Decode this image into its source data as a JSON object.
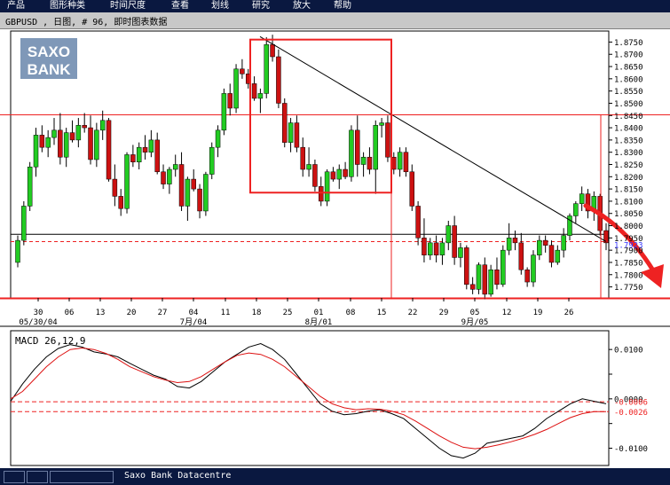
{
  "menu": {
    "items": [
      "产品",
      "图形种类",
      "时间尺度",
      "查看",
      "划线",
      "研究",
      "放大",
      "帮助"
    ]
  },
  "header": {
    "title": "GBPUSD , 日图, # 96, 即时图表数据"
  },
  "logo": {
    "line1": "SAXO",
    "line2": "BANK"
  },
  "status": {
    "text": "Saxo Bank Datacentre"
  },
  "colors": {
    "bull": "#22cc22",
    "bear": "#cc1111",
    "annotation": "#ee2222",
    "accent": "#0a1840"
  },
  "chart_data": [
    {
      "type": "candlestick",
      "title": "",
      "price_axis": {
        "range": [
          1.7705,
          1.8795
        ],
        "ticks": [
          "1.8750",
          "1.8700",
          "1.8650",
          "1.8600",
          "1.8550",
          "1.8500",
          "1.8450",
          "1.8400",
          "1.8350",
          "1.8300",
          "1.8250",
          "1.8200",
          "1.8150",
          "1.8100",
          "1.8050",
          "1.8000",
          "1.7950",
          "1.7900",
          "1.7850",
          "1.7800",
          "1.7750"
        ],
        "last_label": "1.7923"
      },
      "date_axis": {
        "day_labels": [
          "30",
          "06",
          "13",
          "20",
          "27",
          "04",
          "11",
          "18",
          "25",
          "01",
          "08",
          "15",
          "22",
          "29",
          "05",
          "12",
          "19",
          "26"
        ],
        "month_labels": [
          "05/30/04",
          "7月/04",
          "8月/01",
          "9月/05"
        ]
      },
      "trendline": {
        "from": [
          "07/18/04",
          1.8772
        ],
        "to": [
          "09/30/04",
          1.7935
        ]
      },
      "horizontal_levels": [
        1.8453,
        1.7965,
        1.7935
      ],
      "zones": [
        {
          "from": "07/16/04",
          "to": "08/17/04",
          "high": 1.876,
          "low": 1.8135
        },
        {
          "from": "08/17/04",
          "to": "09/29/04",
          "high": 1.8453,
          "low": 1.7705
        }
      ],
      "candles": [
        [
          1.785,
          1.796,
          1.783,
          1.794
        ],
        [
          1.794,
          1.81,
          1.792,
          1.808
        ],
        [
          1.808,
          1.826,
          1.806,
          1.824
        ],
        [
          1.824,
          1.84,
          1.82,
          1.837
        ],
        [
          1.837,
          1.841,
          1.83,
          1.832
        ],
        [
          1.832,
          1.839,
          1.828,
          1.836
        ],
        [
          1.836,
          1.844,
          1.833,
          1.839
        ],
        [
          1.839,
          1.846,
          1.825,
          1.828
        ],
        [
          1.828,
          1.84,
          1.824,
          1.838
        ],
        [
          1.838,
          1.843,
          1.834,
          1.835
        ],
        [
          1.835,
          1.844,
          1.832,
          1.841
        ],
        [
          1.841,
          1.846,
          1.838,
          1.84
        ],
        [
          1.84,
          1.845,
          1.825,
          1.827
        ],
        [
          1.827,
          1.842,
          1.824,
          1.839
        ],
        [
          1.839,
          1.847,
          1.835,
          1.843
        ],
        [
          1.843,
          1.844,
          1.818,
          1.819
        ],
        [
          1.819,
          1.825,
          1.808,
          1.812
        ],
        [
          1.812,
          1.815,
          1.804,
          1.807
        ],
        [
          1.807,
          1.83,
          1.805,
          1.829
        ],
        [
          1.829,
          1.833,
          1.824,
          1.826
        ],
        [
          1.826,
          1.834,
          1.823,
          1.832
        ],
        [
          1.832,
          1.837,
          1.827,
          1.83
        ],
        [
          1.83,
          1.839,
          1.828,
          1.835
        ],
        [
          1.835,
          1.838,
          1.821,
          1.822
        ],
        [
          1.822,
          1.825,
          1.815,
          1.817
        ],
        [
          1.817,
          1.824,
          1.813,
          1.823
        ],
        [
          1.823,
          1.829,
          1.82,
          1.825
        ],
        [
          1.825,
          1.83,
          1.806,
          1.808
        ],
        [
          1.808,
          1.82,
          1.802,
          1.819
        ],
        [
          1.819,
          1.823,
          1.814,
          1.815
        ],
        [
          1.815,
          1.817,
          1.803,
          1.806
        ],
        [
          1.806,
          1.822,
          1.804,
          1.821
        ],
        [
          1.821,
          1.834,
          1.819,
          1.832
        ],
        [
          1.832,
          1.841,
          1.828,
          1.839
        ],
        [
          1.839,
          1.856,
          1.837,
          1.854
        ],
        [
          1.854,
          1.858,
          1.845,
          1.848
        ],
        [
          1.848,
          1.866,
          1.846,
          1.864
        ],
        [
          1.864,
          1.868,
          1.86,
          1.862
        ],
        [
          1.862,
          1.864,
          1.856,
          1.858
        ],
        [
          1.858,
          1.861,
          1.851,
          1.852
        ],
        [
          1.852,
          1.856,
          1.846,
          1.854
        ],
        [
          1.854,
          1.877,
          1.852,
          1.874
        ],
        [
          1.874,
          1.878,
          1.867,
          1.869
        ],
        [
          1.869,
          1.872,
          1.848,
          1.85
        ],
        [
          1.85,
          1.852,
          1.832,
          1.834
        ],
        [
          1.834,
          1.844,
          1.83,
          1.842
        ],
        [
          1.842,
          1.845,
          1.83,
          1.832
        ],
        [
          1.832,
          1.836,
          1.82,
          1.823
        ],
        [
          1.823,
          1.832,
          1.82,
          1.825
        ],
        [
          1.825,
          1.827,
          1.814,
          1.816
        ],
        [
          1.816,
          1.82,
          1.808,
          1.81
        ],
        [
          1.81,
          1.823,
          1.808,
          1.822
        ],
        [
          1.822,
          1.824,
          1.818,
          1.819
        ],
        [
          1.819,
          1.825,
          1.815,
          1.823
        ],
        [
          1.823,
          1.826,
          1.819,
          1.82
        ],
        [
          1.82,
          1.841,
          1.818,
          1.839
        ],
        [
          1.839,
          1.845,
          1.82,
          1.825
        ],
        [
          1.825,
          1.83,
          1.82,
          1.828
        ],
        [
          1.828,
          1.832,
          1.821,
          1.823
        ],
        [
          1.823,
          1.843,
          1.813,
          1.841
        ],
        [
          1.841,
          1.844,
          1.836,
          1.842
        ],
        [
          1.842,
          1.845,
          1.826,
          1.828
        ],
        [
          1.828,
          1.83,
          1.821,
          1.823
        ],
        [
          1.823,
          1.832,
          1.82,
          1.83
        ],
        [
          1.83,
          1.832,
          1.82,
          1.822
        ],
        [
          1.822,
          1.825,
          1.806,
          1.808
        ],
        [
          1.808,
          1.81,
          1.792,
          1.795
        ],
        [
          1.795,
          1.803,
          1.785,
          1.788
        ],
        [
          1.788,
          1.795,
          1.786,
          1.793
        ],
        [
          1.793,
          1.796,
          1.785,
          1.788
        ],
        [
          1.788,
          1.795,
          1.784,
          1.793
        ],
        [
          1.793,
          1.802,
          1.79,
          1.8
        ],
        [
          1.8,
          1.804,
          1.784,
          1.787
        ],
        [
          1.787,
          1.793,
          1.783,
          1.791
        ],
        [
          1.791,
          1.792,
          1.774,
          1.776
        ],
        [
          1.776,
          1.779,
          1.772,
          1.774
        ],
        [
          1.774,
          1.785,
          1.772,
          1.784
        ],
        [
          1.784,
          1.787,
          1.77,
          1.772
        ],
        [
          1.772,
          1.784,
          1.771,
          1.782
        ],
        [
          1.782,
          1.787,
          1.774,
          1.776
        ],
        [
          1.776,
          1.792,
          1.775,
          1.79
        ],
        [
          1.79,
          1.801,
          1.788,
          1.795
        ],
        [
          1.795,
          1.798,
          1.79,
          1.793
        ],
        [
          1.793,
          1.797,
          1.78,
          1.782
        ],
        [
          1.782,
          1.783,
          1.775,
          1.777
        ],
        [
          1.777,
          1.79,
          1.775,
          1.788
        ],
        [
          1.788,
          1.796,
          1.786,
          1.794
        ],
        [
          1.794,
          1.796,
          1.789,
          1.792
        ],
        [
          1.792,
          1.794,
          1.783,
          1.785
        ],
        [
          1.785,
          1.792,
          1.784,
          1.79
        ],
        [
          1.79,
          1.799,
          1.787,
          1.796
        ],
        [
          1.796,
          1.805,
          1.794,
          1.804
        ],
        [
          1.804,
          1.81,
          1.801,
          1.809
        ],
        [
          1.809,
          1.816,
          1.806,
          1.813
        ],
        [
          1.813,
          1.815,
          1.803,
          1.806
        ],
        [
          1.806,
          1.814,
          1.802,
          1.812
        ],
        [
          1.812,
          1.813,
          1.796,
          1.798
        ],
        [
          1.798,
          1.801,
          1.79,
          1.793
        ]
      ]
    },
    {
      "type": "line",
      "title": "MACD 26,12,9",
      "y_ticks": [
        "0.0100",
        "0.0050",
        "0.0000",
        "-0.0050",
        "-0.0100"
      ],
      "ylim": [
        -0.0135,
        0.0138
      ],
      "value_labels": [
        "-0.0006",
        "-0.0026"
      ],
      "series": [
        {
          "color": "#000000",
          "values": [
            -0.0005,
            0.003,
            0.006,
            0.0085,
            0.0102,
            0.011,
            0.0105,
            0.0095,
            0.0091,
            0.0085,
            0.0072,
            0.006,
            0.0048,
            0.004,
            0.0025,
            0.0022,
            0.0035,
            0.0055,
            0.0075,
            0.009,
            0.0105,
            0.0112,
            0.01,
            0.008,
            0.005,
            0.002,
            -0.001,
            -0.0025,
            -0.0032,
            -0.003,
            -0.0025,
            -0.0022,
            -0.003,
            -0.004,
            -0.006,
            -0.008,
            -0.01,
            -0.0115,
            -0.012,
            -0.011,
            -0.009,
            -0.0085,
            -0.008,
            -0.0075,
            -0.006,
            -0.004,
            -0.0025,
            -0.001,
            0.0,
            -0.0005,
            -0.001
          ]
        },
        {
          "color": "#dd1111",
          "values": [
            0.0,
            0.0015,
            0.004,
            0.0065,
            0.0085,
            0.01,
            0.0103,
            0.01,
            0.0092,
            0.008,
            0.0065,
            0.0055,
            0.0045,
            0.0038,
            0.0033,
            0.0035,
            0.0045,
            0.006,
            0.0075,
            0.0088,
            0.0093,
            0.009,
            0.008,
            0.0065,
            0.0045,
            0.0025,
            0.0005,
            -0.001,
            -0.0018,
            -0.0022,
            -0.002,
            -0.0021,
            -0.0025,
            -0.0032,
            -0.0045,
            -0.006,
            -0.0075,
            -0.0088,
            -0.0098,
            -0.0101,
            -0.0098,
            -0.0093,
            -0.0087,
            -0.008,
            -0.0072,
            -0.0062,
            -0.005,
            -0.0038,
            -0.003,
            -0.0026,
            -0.0026
          ]
        }
      ],
      "reference_levels": [
        -0.0006,
        -0.0026
      ]
    }
  ]
}
